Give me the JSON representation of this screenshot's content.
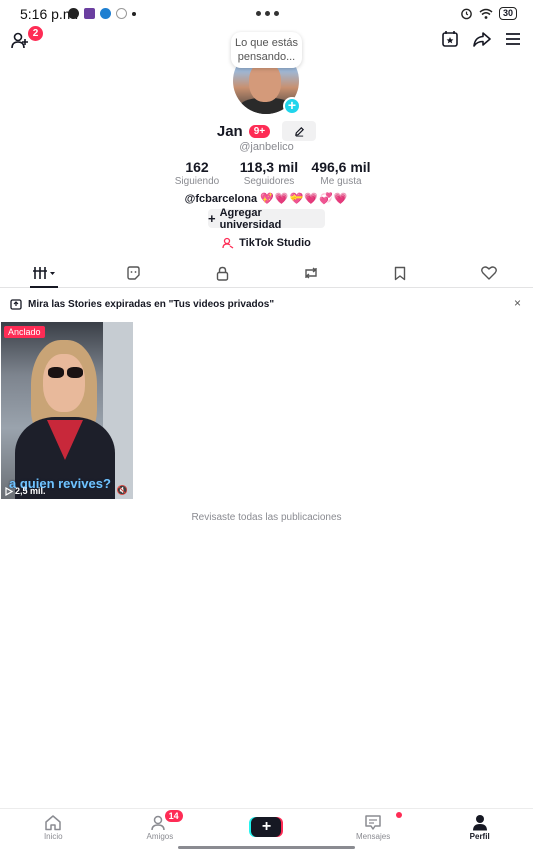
{
  "status_bar": {
    "time": "5:16 p.m.",
    "battery": "30",
    "app_icons": [
      "messenger-icon",
      "twitch-icon",
      "edge-icon",
      "tiktok-icon"
    ]
  },
  "top_bar": {
    "friend_requests_badge": "2",
    "right_icons": [
      "creator-calendar-icon",
      "share-icon",
      "menu-icon"
    ]
  },
  "profile": {
    "thought_bubble": "Lo que estás pensando...",
    "name": "Jan",
    "name_badge": "9+",
    "handle": "@janbelico",
    "stats": [
      {
        "value": "162",
        "label": "Siguiendo"
      },
      {
        "value": "118,3 mil",
        "label": "Seguidores"
      },
      {
        "value": "496,6 mil",
        "label": "Me gusta"
      }
    ],
    "bio_mention": "@fcbarcelona",
    "bio_emojis": "💖💗💝💗💞💗",
    "add_university_label": "Agregar universidad",
    "studio_label": "TikTok Studio"
  },
  "tabs": [
    {
      "icon": "videos-grid-icon",
      "active": true
    },
    {
      "icon": "stickers-icon",
      "active": false
    },
    {
      "icon": "lock-icon",
      "active": false
    },
    {
      "icon": "repost-icon",
      "active": false
    },
    {
      "icon": "bookmark-icon",
      "active": false
    },
    {
      "icon": "heart-icon",
      "active": false
    }
  ],
  "notice": {
    "text": "Mira las Stories expiradas en \"Tus videos privados\"",
    "close": "×"
  },
  "videos": [
    {
      "pinned_label": "Anclado",
      "caption": "a quien revives?",
      "views": "2,5 mil."
    }
  ],
  "end_text": "Revisaste todas las publicaciones",
  "bottom_nav": {
    "items": [
      {
        "label": "Inicio",
        "icon": "home-icon"
      },
      {
        "label": "Amigos",
        "icon": "friends-icon",
        "badge": "14"
      },
      {
        "label": "",
        "icon": "create-icon"
      },
      {
        "label": "Mensajes",
        "icon": "inbox-icon"
      },
      {
        "label": "Perfil",
        "icon": "profile-icon",
        "active": true
      }
    ]
  },
  "colors": {
    "accent": "#fe2c55",
    "cyan": "#20d5ec",
    "text": "#161823",
    "muted": "#8a8b91"
  }
}
